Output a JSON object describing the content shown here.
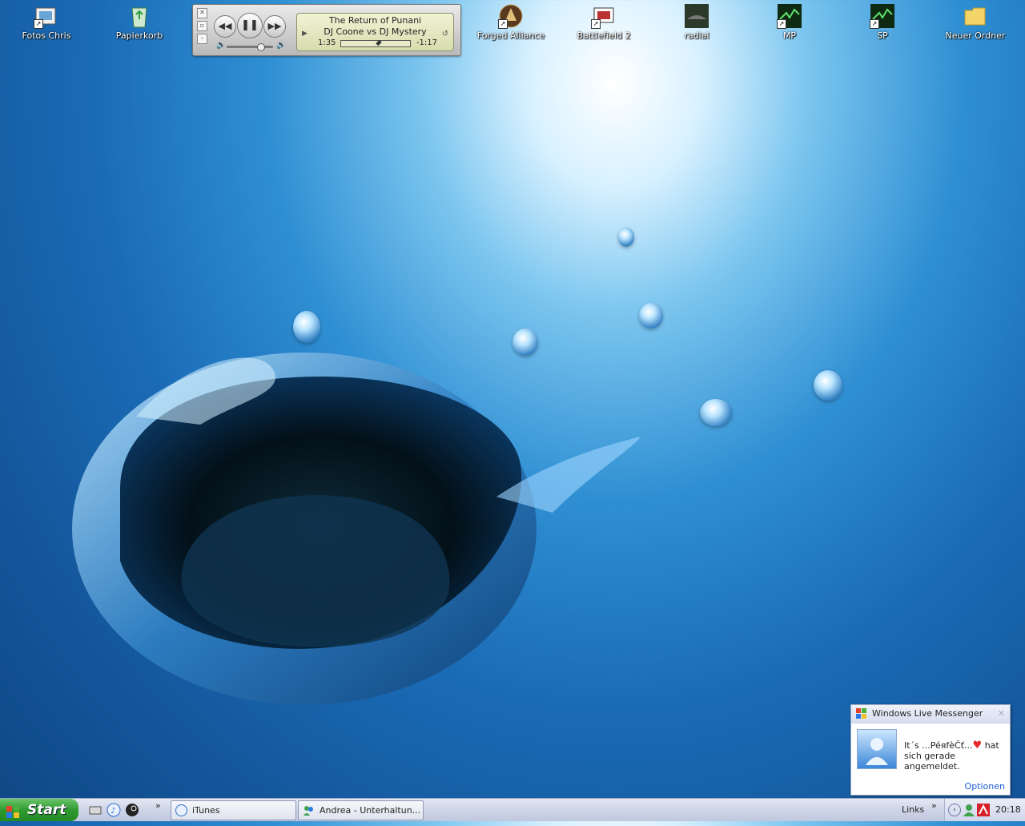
{
  "desktop": {
    "icons": [
      {
        "label": "Fotos Chris",
        "icon": "photo-folder-icon"
      },
      {
        "label": "Papierkorb",
        "icon": "recycle-bin-icon"
      },
      {
        "label": "Forged Alliance",
        "icon": "forged-alliance-icon"
      },
      {
        "label": "Battlefield 2",
        "icon": "battlefield-icon"
      },
      {
        "label": "radial",
        "icon": "car-icon"
      },
      {
        "label": "MP",
        "icon": "cod4-mp-icon"
      },
      {
        "label": "SP",
        "icon": "cod4-sp-icon"
      },
      {
        "label": "Neuer Ordner",
        "icon": "folder-icon"
      }
    ]
  },
  "itunes": {
    "song": "The Return of Punani",
    "artist": "DJ Coone vs DJ Mystery",
    "elapsed": "1:35",
    "remaining": "-1:17",
    "progress": 0.55,
    "volume": 0.75
  },
  "taskbar": {
    "start_label": "Start",
    "tasks": [
      {
        "label": "iTunes",
        "icon": "itunes-icon"
      },
      {
        "label": "Andrea - Unterhaltun...",
        "icon": "messenger-icon"
      }
    ],
    "links_label": "Links",
    "clock": "20:18"
  },
  "toast": {
    "title": "Windows Live Messenger",
    "name": "It´s ...PéяfèČť...",
    "message_suffix": "hat",
    "message_line2": "sich gerade angemeldet.",
    "options_label": "Optionen"
  },
  "colors": {
    "start_green": "#2f9a2f",
    "link_blue": "#1a5bd6",
    "heart_red": "#e8282b"
  }
}
